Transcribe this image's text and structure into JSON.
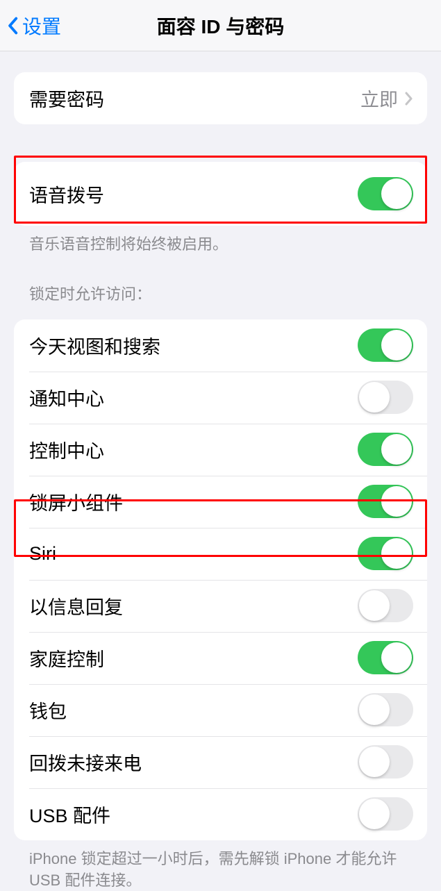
{
  "nav": {
    "back_label": "设置",
    "title": "面容 ID 与密码"
  },
  "passcode_section": {
    "require_passcode_label": "需要密码",
    "require_passcode_value": "立即"
  },
  "voice_dial": {
    "label": "语音拨号",
    "enabled": true,
    "footer": "音乐语音控制将始终被启用。"
  },
  "allow_access_header": "锁定时允许访问：",
  "allow_access_items": [
    {
      "label": "今天视图和搜索",
      "enabled": true
    },
    {
      "label": "通知中心",
      "enabled": false
    },
    {
      "label": "控制中心",
      "enabled": true
    },
    {
      "label": "锁屏小组件",
      "enabled": true
    },
    {
      "label": "Siri",
      "enabled": true
    },
    {
      "label": "以信息回复",
      "enabled": false
    },
    {
      "label": "家庭控制",
      "enabled": true
    },
    {
      "label": "钱包",
      "enabled": false
    },
    {
      "label": "回拨未接来电",
      "enabled": false
    },
    {
      "label": "USB 配件",
      "enabled": false
    }
  ],
  "usb_footer": "iPhone 锁定超过一小时后，需先解锁 iPhone 才能允许 USB 配件连接。"
}
